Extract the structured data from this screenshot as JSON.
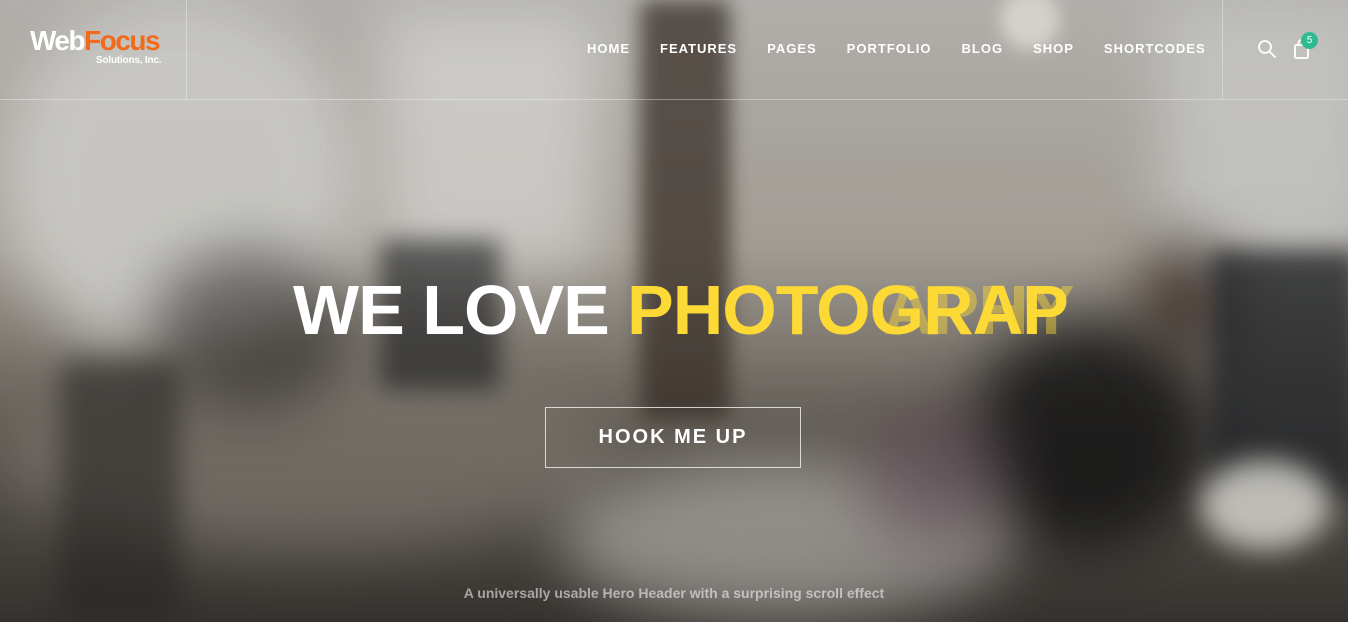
{
  "brand": {
    "logo_part1": "Web",
    "logo_part2": "Focus",
    "logo_subtitle": "Solutions, Inc.",
    "accent_color": "#f26a1b"
  },
  "nav": {
    "items": [
      {
        "label": "HOME"
      },
      {
        "label": "FEATURES"
      },
      {
        "label": "PAGES"
      },
      {
        "label": "PORTFOLIO"
      },
      {
        "label": "BLOG"
      },
      {
        "label": "SHOP"
      },
      {
        "label": "SHORTCODES"
      }
    ]
  },
  "header_actions": {
    "search_icon": "search-icon",
    "cart_icon": "shopping-bag-icon",
    "cart_count": "5",
    "badge_color": "#2fbb8f"
  },
  "hero": {
    "headline_white": "WE LOVE ",
    "headline_yellow": "PHOTOGRAP",
    "headline_ghost": "APHY",
    "highlight_color": "#fdd936",
    "cta_label": "HOOK ME UP",
    "tagline": "A universally usable Hero Header with a surprising scroll effect"
  }
}
